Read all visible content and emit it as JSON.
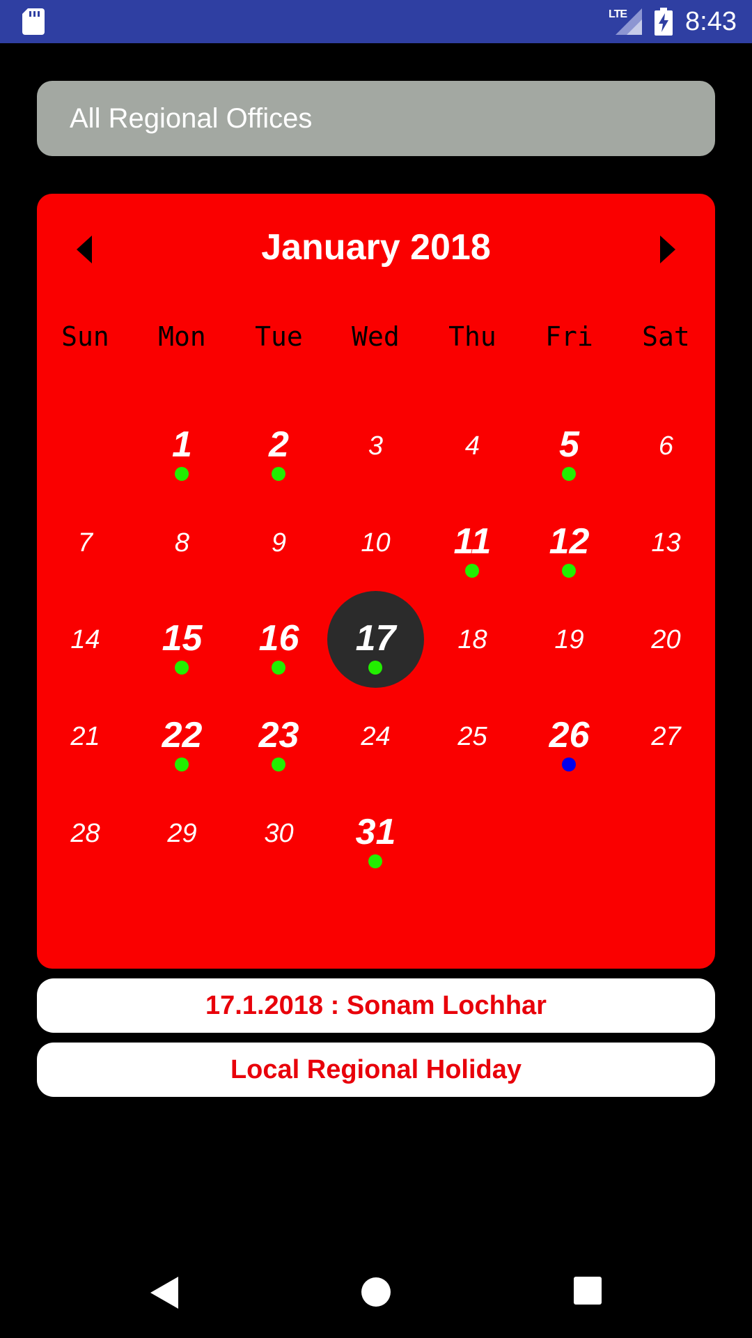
{
  "status_bar": {
    "network_label": "LTE",
    "time": "8:43",
    "icons": [
      "sd-card-icon",
      "signal-icon",
      "battery-charging-icon"
    ]
  },
  "office_selector": {
    "selected_value": "All Regional Offices"
  },
  "calendar": {
    "month_title": "January 2018",
    "weekdays": [
      "Sun",
      "Mon",
      "Tue",
      "Wed",
      "Thu",
      "Fri",
      "Sat"
    ],
    "first_weekday_index": 1,
    "selected_day": 17,
    "colors": {
      "background": "#fa0000",
      "selected_circle": "#2b2b2b",
      "dot_green": "#22ee00",
      "dot_blue": "#0000ee"
    },
    "days": [
      {
        "day": "1",
        "event": "green"
      },
      {
        "day": "2",
        "event": "green"
      },
      {
        "day": "3",
        "event": null
      },
      {
        "day": "4",
        "event": null
      },
      {
        "day": "5",
        "event": "green"
      },
      {
        "day": "6",
        "event": null
      },
      {
        "day": "7",
        "event": null
      },
      {
        "day": "8",
        "event": null
      },
      {
        "day": "9",
        "event": null
      },
      {
        "day": "10",
        "event": null
      },
      {
        "day": "11",
        "event": "green"
      },
      {
        "day": "12",
        "event": "green"
      },
      {
        "day": "13",
        "event": null
      },
      {
        "day": "14",
        "event": null
      },
      {
        "day": "15",
        "event": "green"
      },
      {
        "day": "16",
        "event": "green"
      },
      {
        "day": "17",
        "event": "green"
      },
      {
        "day": "18",
        "event": null
      },
      {
        "day": "19",
        "event": null
      },
      {
        "day": "20",
        "event": null
      },
      {
        "day": "21",
        "event": null
      },
      {
        "day": "22",
        "event": "green"
      },
      {
        "day": "23",
        "event": "green"
      },
      {
        "day": "24",
        "event": null
      },
      {
        "day": "25",
        "event": null
      },
      {
        "day": "26",
        "event": "blue"
      },
      {
        "day": "27",
        "event": null
      },
      {
        "day": "28",
        "event": null
      },
      {
        "day": "29",
        "event": null
      },
      {
        "day": "30",
        "event": null
      },
      {
        "day": "31",
        "event": "green"
      }
    ]
  },
  "event_info": {
    "date_and_name": "17.1.2018 : Sonam Lochhar",
    "holiday_type": "Local Regional Holiday"
  },
  "navigation_bar": {
    "icons": [
      "back-icon",
      "home-icon",
      "recents-icon"
    ]
  }
}
